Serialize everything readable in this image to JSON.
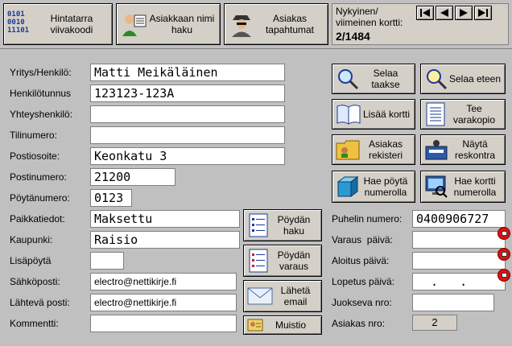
{
  "top_buttons": {
    "barcode": "Hintatarra viivakoodi",
    "barcode_glyph": "0101 0010 11101",
    "name_search": "Asiakkaan nimi haku",
    "events": "Asiakas tapahtumat"
  },
  "record_info": {
    "label": "Nykyinen/ viimeinen kortti:",
    "value": "2/1484"
  },
  "labels": {
    "company": "Yritys/Henkilö:",
    "id": "Henkilötunnus",
    "contact": "Yhteyshenkilö:",
    "account": "Tilinumero:",
    "address": "Postiosoite:",
    "postcode": "Postinumero:",
    "table": "Pöytänumero:",
    "place_info": "Paikkatiedot:",
    "city": "Kaupunki:",
    "extra_table": "Lisäpöytä",
    "email": "Sähköposti:",
    "sending_email": "Lähtevä posti:",
    "comment": "Kommentti:",
    "phone": "Puhelin numero:",
    "reservation_date": "Varaus  päivä:",
    "start_date": "Aloitus päivä:",
    "end_date": "Lopetus päivä:",
    "serial": "Juokseva nro:",
    "customer_no": "Asiakas nro:"
  },
  "values": {
    "company": "Matti Meikäläinen",
    "id": "123123-123A",
    "contact": "",
    "account": "",
    "address": "Keonkatu 3",
    "postcode": "21200",
    "table": "0123",
    "place_info": "Maksettu",
    "city": "Raisio",
    "extra_table": "",
    "email": "electro@nettikirje.fi",
    "sending_email": "electro@nettikirje.fi",
    "comment": "",
    "phone": "0400906727",
    "reservation_date": "",
    "start_date": "",
    "end_date": "  .   .",
    "serial": "",
    "customer_no": "2"
  },
  "right_buttons": {
    "browse_back": "Selaa taakse",
    "browse_forward": "Selaa eteen",
    "add_card": "Lisää kortti",
    "backup": "Tee varakopio",
    "customer_registry": "Asiakas rekisteri",
    "show_ledger": "Näytä reskontra",
    "fetch_table": "Hae pöytä numerolla",
    "fetch_card": "Hae kortti numerolla"
  },
  "mid_buttons": {
    "table_search": "Pöydän haku",
    "table_reservation": "Pöydän varaus",
    "send_email": "Lähetä email",
    "memo": "Muistio"
  }
}
